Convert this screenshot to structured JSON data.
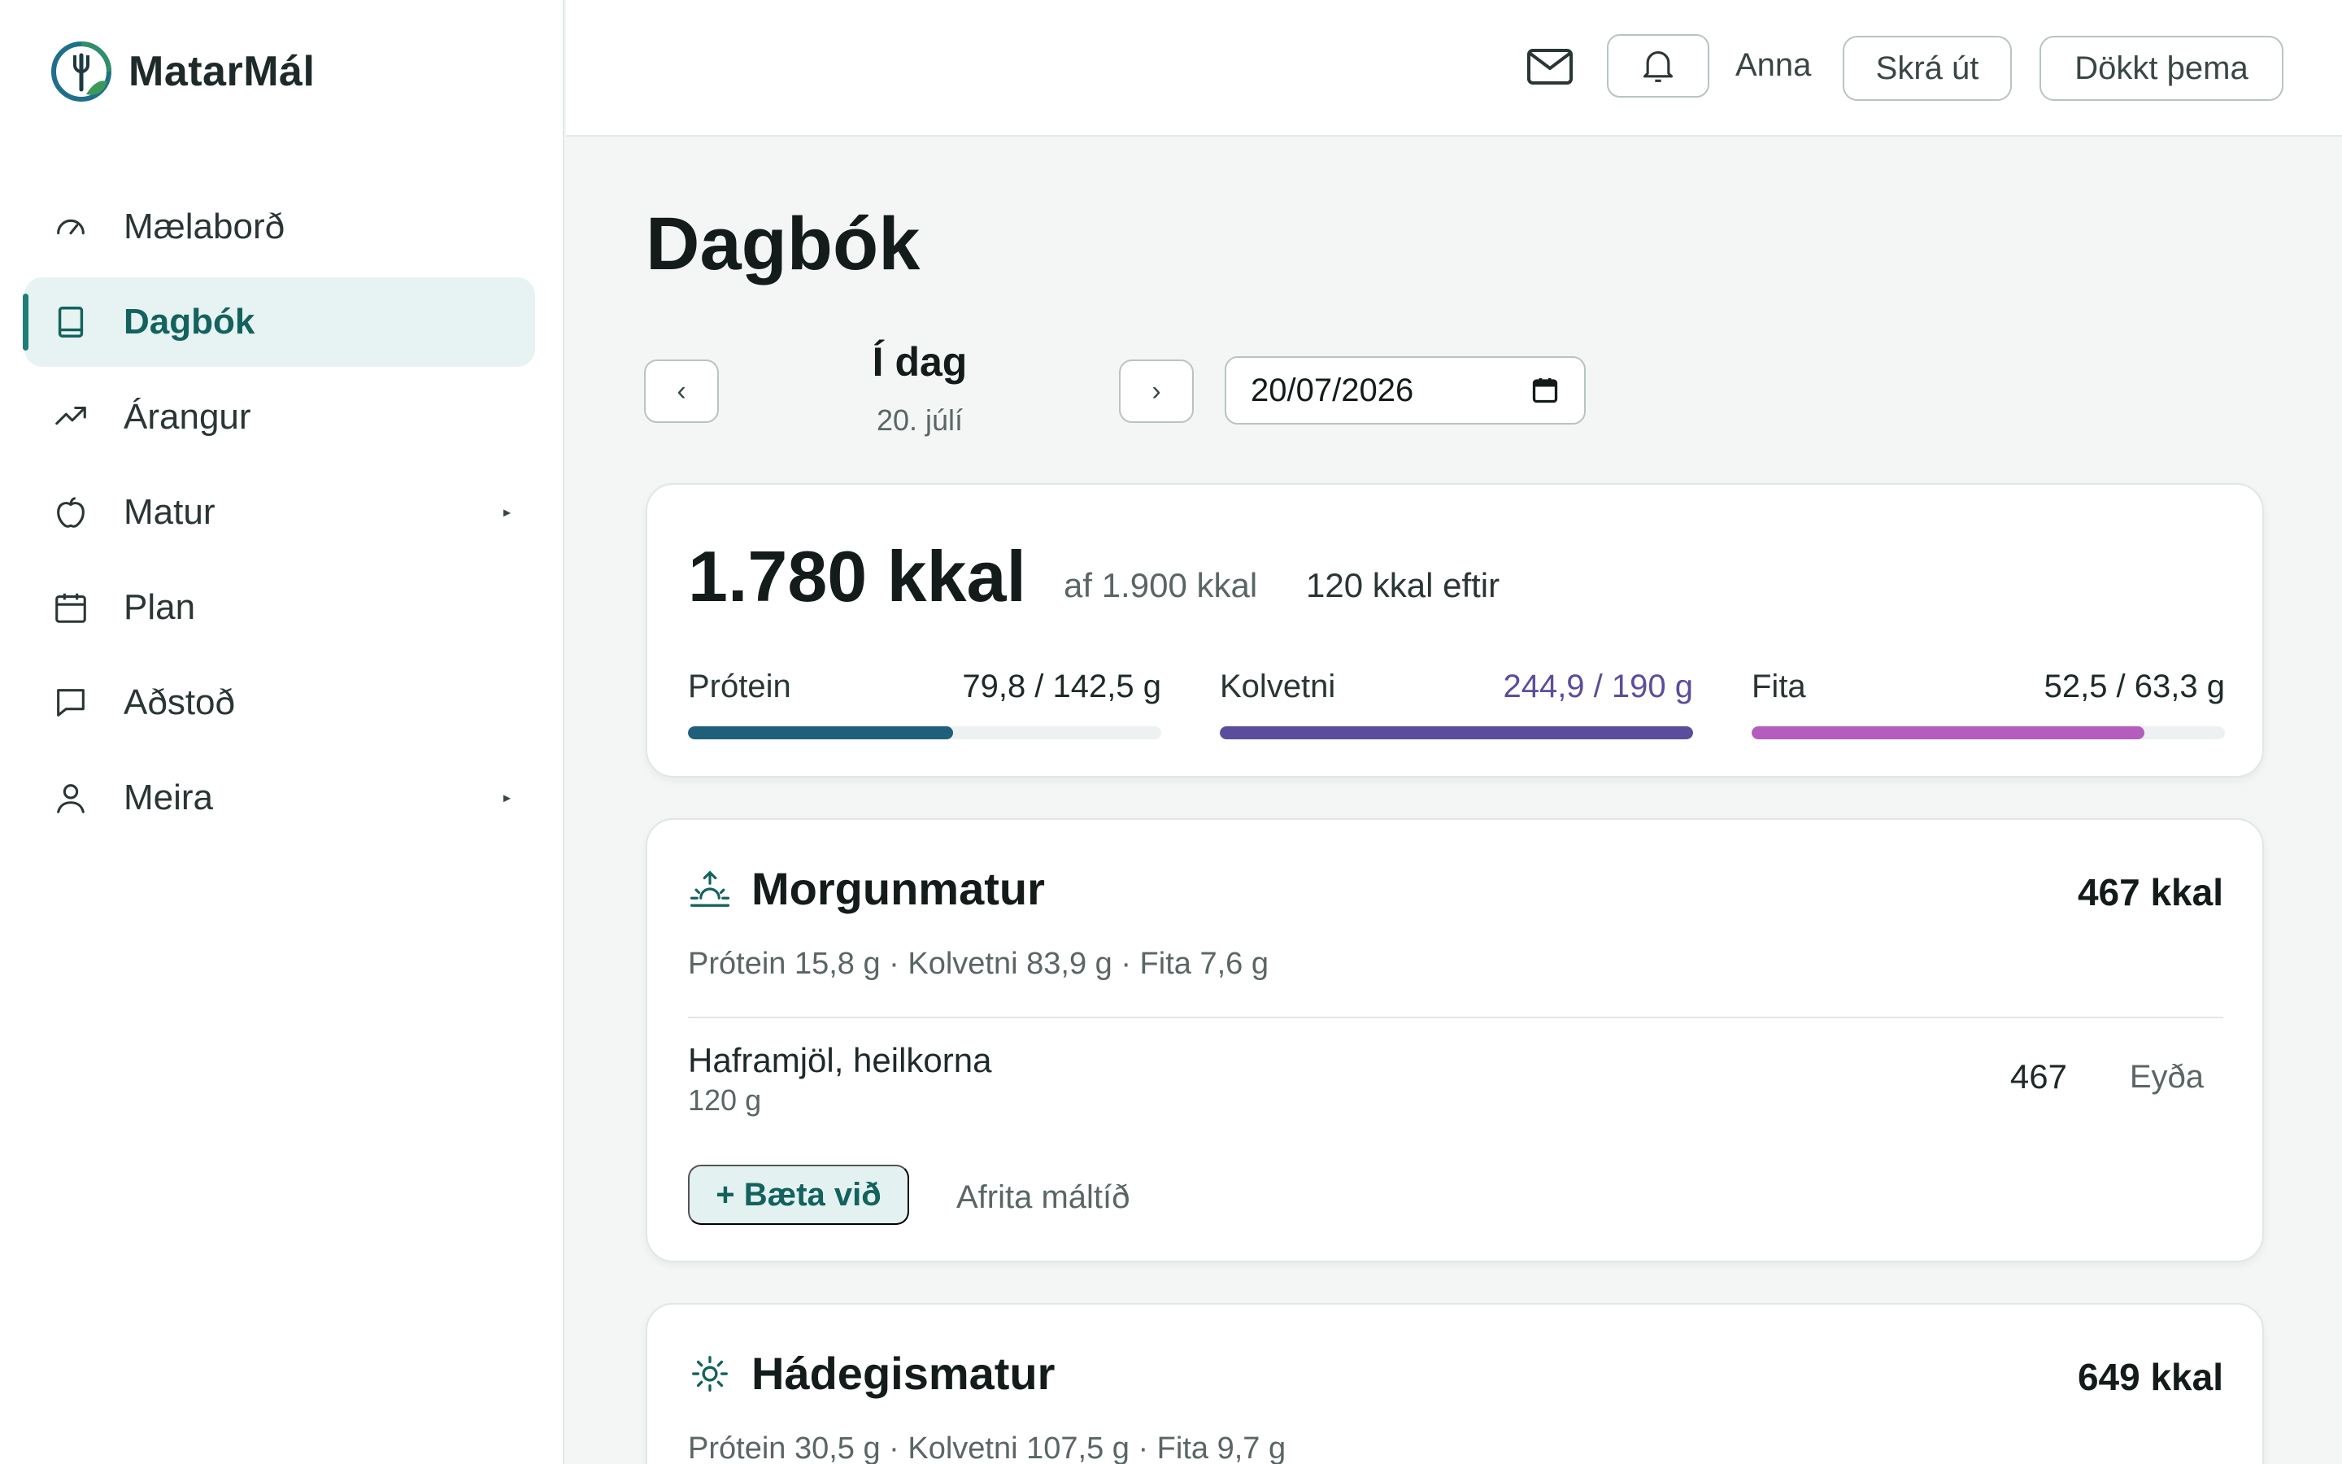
{
  "brand": {
    "name": "MatarMál"
  },
  "sidebar": {
    "items": [
      {
        "label": "Mælaborð",
        "icon": "gauge-icon"
      },
      {
        "label": "Dagbók",
        "icon": "book-icon",
        "active": true
      },
      {
        "label": "Árangur",
        "icon": "trend-up-icon"
      },
      {
        "label": "Matur",
        "icon": "apple-icon",
        "has_submenu": true
      },
      {
        "label": "Plan",
        "icon": "calendar-icon"
      },
      {
        "label": "Aðstoð",
        "icon": "chat-bubble-icon"
      },
      {
        "label": "Meira",
        "icon": "user-icon",
        "has_submenu": true
      }
    ],
    "caret": "▸"
  },
  "topbar": {
    "user": "Anna",
    "logout_label": "Skrá út",
    "theme_label": "Dökkt þema"
  },
  "page": {
    "title": "Dagbók",
    "day_label": "Í dag",
    "day_sub": "20. júlí",
    "prev": "‹",
    "next": "›",
    "date_value": "20/07/2026"
  },
  "summary": {
    "kcal": "1.780 kkal",
    "of_goal": "af 1.900 kkal",
    "remaining": "120 kkal eftir",
    "macros": [
      {
        "name": "Prótein",
        "value": "79,8 / 142,5 g",
        "fraction": 0.56,
        "color": "#1f5f7a",
        "value_color": "#1e2a29"
      },
      {
        "name": "Kolvetni",
        "value": "244,9 / 190 g",
        "fraction": 1.0,
        "color": "#5b4d9c",
        "value_color": "#5b4d9c"
      },
      {
        "name": "Fita",
        "value": "52,5 / 63,3 g",
        "fraction": 0.83,
        "color": "#b45dbd",
        "value_color": "#1e2a29"
      }
    ]
  },
  "meals": [
    {
      "title": "Morgunmatur",
      "icon": "sunrise-icon",
      "kcal": "467 kkal",
      "macros": "Prótein 15,8 g · Kolvetni 83,9 g · Fita 7,6 g",
      "items": [
        {
          "name": "Haframjöl, heilkorna",
          "qty": "120 g",
          "kcal": "467",
          "delete_label": "Eyða"
        }
      ],
      "add_label": "+ Bæta við",
      "copy_label": "Afrita máltíð"
    },
    {
      "title": "Hádegismatur",
      "icon": "sun-icon",
      "kcal": "649 kkal",
      "macros": "Prótein 30,5 g · Kolvetni 107,5 g · Fita 9,7 g"
    }
  ]
}
